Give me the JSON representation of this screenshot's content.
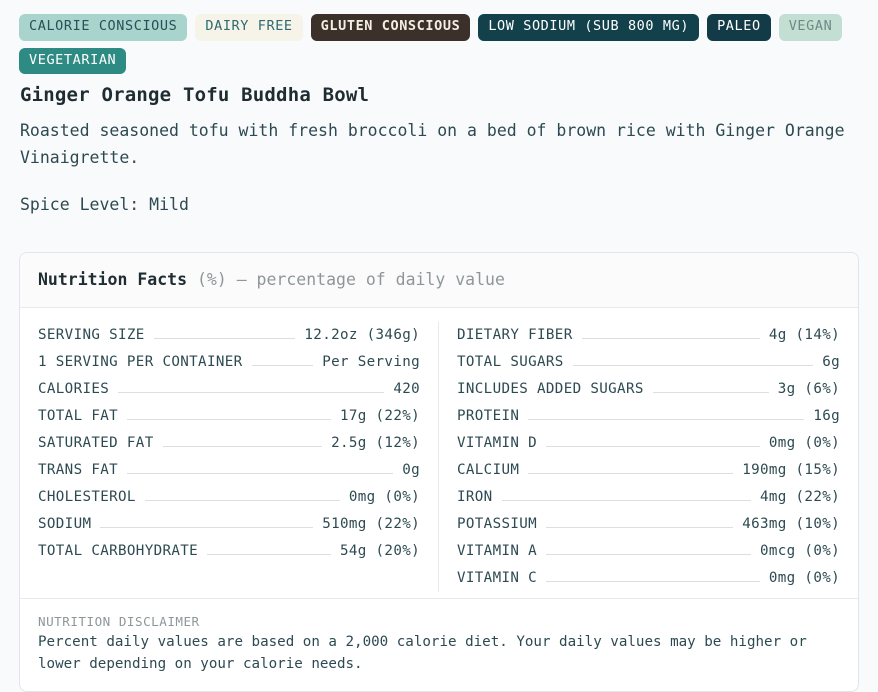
{
  "tags": [
    {
      "label": "CALORIE CONSCIOUS",
      "style": "tag-calorie"
    },
    {
      "label": "DAIRY FREE",
      "style": "tag-dairy"
    },
    {
      "label": "GLUTEN CONSCIOUS",
      "style": "tag-gluten"
    },
    {
      "label": "LOW SODIUM (SUB 800 MG)",
      "style": "tag-lowsodium"
    },
    {
      "label": "PALEO",
      "style": "tag-paleo"
    },
    {
      "label": "VEGAN",
      "style": "tag-vegan"
    },
    {
      "label": "VEGETARIAN",
      "style": "tag-vegetarian"
    }
  ],
  "dish": {
    "title": "Ginger Orange Tofu Buddha Bowl",
    "description": "Roasted seasoned tofu with fresh broccoli on a bed of brown rice with Ginger Orange Vinaigrette.",
    "spice_level": "Spice Level: Mild"
  },
  "nutrition": {
    "header_strong": "Nutrition Facts",
    "header_sub": "(%) – percentage of daily value",
    "left_rows": [
      {
        "label": "SERVING SIZE",
        "value": "12.2oz (346g)"
      },
      {
        "label": "1 SERVING PER CONTAINER",
        "value": "Per Serving"
      },
      {
        "label": "CALORIES",
        "value": "420"
      },
      {
        "label": "TOTAL FAT",
        "value": "17g (22%)"
      },
      {
        "label": "SATURATED FAT",
        "value": "2.5g (12%)"
      },
      {
        "label": "TRANS FAT",
        "value": "0g"
      },
      {
        "label": "CHOLESTEROL",
        "value": "0mg (0%)"
      },
      {
        "label": "SODIUM",
        "value": "510mg (22%)"
      },
      {
        "label": "TOTAL CARBOHYDRATE",
        "value": "54g (20%)"
      }
    ],
    "right_rows": [
      {
        "label": "DIETARY FIBER",
        "value": "4g (14%)"
      },
      {
        "label": "TOTAL SUGARS",
        "value": "6g"
      },
      {
        "label": "INCLUDES ADDED SUGARS",
        "value": "3g (6%)"
      },
      {
        "label": "PROTEIN",
        "value": "16g"
      },
      {
        "label": "VITAMIN D",
        "value": "0mg (0%)"
      },
      {
        "label": "CALCIUM",
        "value": "190mg (15%)"
      },
      {
        "label": "IRON",
        "value": "4mg (22%)"
      },
      {
        "label": "POTASSIUM",
        "value": "463mg (10%)"
      },
      {
        "label": "VITAMIN A",
        "value": "0mcg (0%)"
      },
      {
        "label": "VITAMIN C",
        "value": "0mg (0%)"
      }
    ]
  },
  "disclaimer": {
    "title": "NUTRITION DISCLAIMER",
    "text": "Percent daily values are based on a 2,000 calorie diet. Your daily values may be higher or lower depending on your calorie needs."
  },
  "colors": {
    "page_background": "#f9fafb",
    "text_primary": "#2d4a52",
    "heading": "#1f2d33",
    "muted": "#8f9699",
    "card_border": "#e3e6e8",
    "leader_line": "#dcdfe1",
    "accent_teal": "#2e8b84",
    "accent_dark": "#12414b",
    "accent_brown": "#3b312a"
  }
}
